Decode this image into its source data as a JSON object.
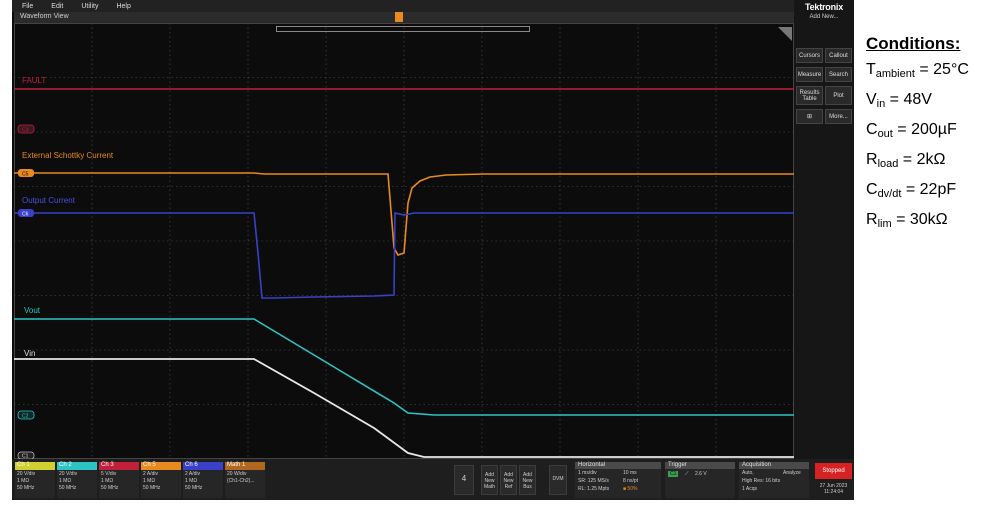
{
  "menu": [
    "File",
    "Edit",
    "Utility",
    "Help"
  ],
  "view_title": "Waveform View",
  "trigger_marker": "T",
  "channel_labels": [
    {
      "text": "FAULT",
      "color": "#c0203a"
    },
    {
      "text": "External Schottky Current",
      "color": "#e88a1e"
    },
    {
      "text": "Output Current",
      "color": "#3a40c8"
    },
    {
      "text": "Vout",
      "color": "#2ec4c4"
    },
    {
      "text": "Vin",
      "color": "#e0e0e0"
    }
  ],
  "channel_markers": [
    "C3",
    "C5",
    "C6",
    "C2",
    "C1"
  ],
  "brand": "Tektronix",
  "add_new": "Add New...",
  "right_buttons": [
    "Cursors",
    "Callout",
    "Measure",
    "Search",
    "Results Table",
    "Plot",
    "More..."
  ],
  "channels": [
    {
      "name": "Ch 1",
      "color": "#cfcf30",
      "l1": "20 V/div",
      "l2": "1 MΩ",
      "l3": "50 MHz"
    },
    {
      "name": "Ch 2",
      "color": "#2ec4c4",
      "l1": "20 V/div",
      "l2": "1 MΩ",
      "l3": "50 MHz"
    },
    {
      "name": "Ch 3",
      "color": "#c0203a",
      "l1": "5 V/div",
      "l2": "1 MΩ",
      "l3": "50 MHz"
    },
    {
      "name": "Ch 5",
      "color": "#e88a1e",
      "l1": "2 A/div",
      "l2": "1 MΩ",
      "l3": "50 MHz"
    },
    {
      "name": "Ch 6",
      "color": "#3a40c8",
      "l1": "2 A/div",
      "l2": "1 MΩ",
      "l3": "50 MHz"
    },
    {
      "name": "Math 1",
      "color": "#b06820",
      "l1": "20 W/div",
      "l2": "(Ch1-Ch2)...",
      "l3": ""
    }
  ],
  "bottom_buttons": {
    "count": "4",
    "add_math": "Add New Math",
    "add_ref": "Add New Ref",
    "add_bus": "Add New Bus",
    "dvm": "DVM"
  },
  "horizontal": {
    "title": "Horizontal",
    "scale": "1 ms/div",
    "length": "10 ms",
    "sr": "SR: 125 MS/s",
    "pt": "8 ns/pt",
    "rl": "RL: 1.25 Mpts",
    "pos": "50%"
  },
  "trigger": {
    "title": "Trigger",
    "src": "C1",
    "level": "2.6 V"
  },
  "acquisition": {
    "title": "Acquisition",
    "mode": "Auto,",
    "analyze": "Analyze",
    "res": "High Res: 16 bits",
    "acqs": "1 Acqs"
  },
  "status": "Stopped",
  "date": "27 Jun 2023",
  "time": "11:24:04",
  "conditions": {
    "title": "Conditions:",
    "lines": [
      {
        "main": "T",
        "sub": "ambient",
        "rest": " = 25°C"
      },
      {
        "main": "V",
        "sub": "in",
        "rest": " = 48V"
      },
      {
        "main": "C",
        "sub": "out",
        "rest": " = 200µF"
      },
      {
        "main": "R",
        "sub": "load",
        "rest": " = 2kΩ"
      },
      {
        "main": "C",
        "sub": "dv/dt",
        "rest": " = 22pF"
      },
      {
        "main": "R",
        "sub": "lim",
        "rest": " = 30kΩ"
      }
    ]
  },
  "colors": {
    "fault": "#c0203a",
    "schottky": "#e88a1e",
    "iout": "#3a40c8",
    "vout": "#2ec4c4",
    "vin": "#202020"
  }
}
